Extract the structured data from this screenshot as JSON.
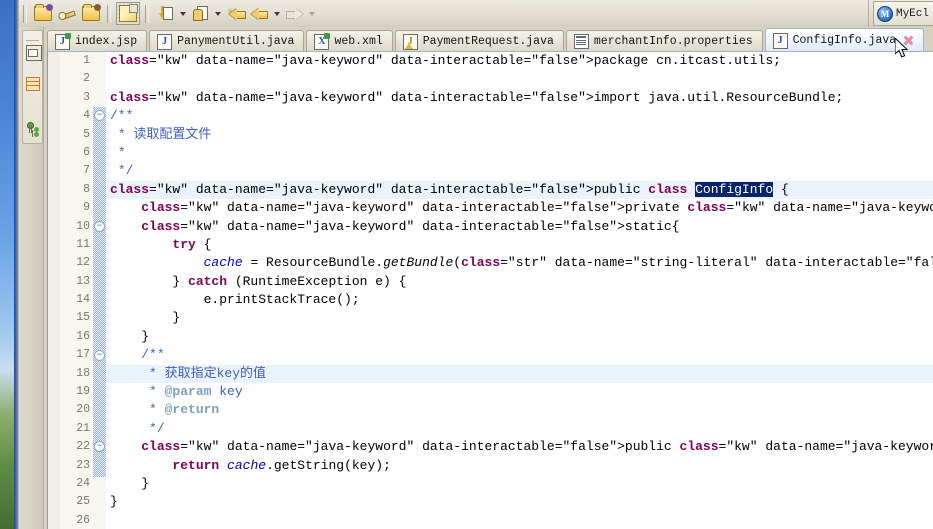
{
  "window": {
    "perspective_label": "MyEcl",
    "perspective_icon": "myeclipse-icon"
  },
  "toolbar": {
    "items": [
      {
        "name": "open-type-button",
        "icon": "folder-purple-icon",
        "tooltip": "Open Type"
      },
      {
        "name": "new-wizard-button",
        "icon": "magic-wand-icon",
        "tooltip": "New Wizard"
      },
      {
        "name": "open-resource-button",
        "icon": "folder-brown-icon",
        "tooltip": "Open Resource"
      },
      {
        "name": "save-button",
        "icon": "save-java-icon",
        "tooltip": "Save"
      },
      {
        "name": "run-button",
        "icon": "download-page-icon",
        "tooltip": "Run"
      },
      {
        "name": "run-dropdown",
        "icon": "chevron-down-icon",
        "tooltip": "Run History"
      },
      {
        "name": "external-tools-button",
        "icon": "hand-page-icon",
        "tooltip": "External Tools"
      },
      {
        "name": "external-tools-dropdown",
        "icon": "chevron-down-icon",
        "tooltip": "External Tools History"
      },
      {
        "name": "next-annotation-button",
        "icon": "sparkle-arrow-left-icon",
        "tooltip": "Next Annotation"
      },
      {
        "name": "back-button",
        "icon": "arrow-left-icon",
        "tooltip": "Back"
      },
      {
        "name": "back-dropdown",
        "icon": "chevron-down-icon",
        "tooltip": "Back History"
      },
      {
        "name": "forward-button",
        "icon": "arrow-right-icon",
        "tooltip": "Forward"
      },
      {
        "name": "forward-dropdown",
        "icon": "chevron-down-icon",
        "tooltip": "Forward History"
      }
    ]
  },
  "fastview": {
    "items": [
      {
        "name": "restore-view-button",
        "icon": "restore-icon"
      },
      {
        "name": "outline-view-button",
        "icon": "outline-icon"
      },
      {
        "name": "hierarchy-view-button",
        "icon": "hierarchy-icon"
      }
    ]
  },
  "editor": {
    "tabs": [
      {
        "label": "index.jsp",
        "icon": "jsp-file-icon",
        "active": false,
        "closable": false
      },
      {
        "label": "PanymentUtil.java",
        "icon": "java-file-icon",
        "active": false,
        "closable": false
      },
      {
        "label": "web.xml",
        "icon": "xml-file-icon",
        "active": false,
        "closable": false
      },
      {
        "label": "PaymentRequest.java",
        "icon": "java-warning-icon",
        "active": false,
        "closable": false
      },
      {
        "label": "merchantInfo.properties",
        "icon": "properties-file-icon",
        "active": false,
        "closable": false
      },
      {
        "label": "ConfigInfo.java",
        "icon": "java-file-icon",
        "active": true,
        "closable": true
      }
    ],
    "close_icon": "close-icon",
    "first_line": 1,
    "last_line": 26,
    "highlighted_lines": [
      8,
      18
    ],
    "selection_text": "ConfigInfo",
    "fold_markers": [
      4,
      10,
      17,
      22
    ],
    "lines": [
      {
        "n": 1,
        "text": "package cn.itcast.utils;"
      },
      {
        "n": 2,
        "text": ""
      },
      {
        "n": 3,
        "text": "import java.util.ResourceBundle;"
      },
      {
        "n": 4,
        "text": "/**"
      },
      {
        "n": 5,
        "text": " * 读取配置文件"
      },
      {
        "n": 6,
        "text": " *"
      },
      {
        "n": 7,
        "text": " */"
      },
      {
        "n": 8,
        "text": "public class ConfigInfo {"
      },
      {
        "n": 9,
        "text": "    private static ResourceBundle cache = null;"
      },
      {
        "n": 10,
        "text": "    static{"
      },
      {
        "n": 11,
        "text": "        try {"
      },
      {
        "n": 12,
        "text": "            cache = ResourceBundle.getBundle(\"merchantInfo\");"
      },
      {
        "n": 13,
        "text": "        } catch (RuntimeException e) {"
      },
      {
        "n": 14,
        "text": "            e.printStackTrace();"
      },
      {
        "n": 15,
        "text": "        }"
      },
      {
        "n": 16,
        "text": "    }"
      },
      {
        "n": 17,
        "text": "    /**"
      },
      {
        "n": 18,
        "text": "     * 获取指定key的值"
      },
      {
        "n": 19,
        "text": "     * @param key"
      },
      {
        "n": 20,
        "text": "     * @return"
      },
      {
        "n": 21,
        "text": "     */"
      },
      {
        "n": 22,
        "text": "    public static String getValue(String key){"
      },
      {
        "n": 23,
        "text": "        return cache.getString(key);"
      },
      {
        "n": 24,
        "text": "    }"
      },
      {
        "n": 25,
        "text": "}"
      },
      {
        "n": 26,
        "text": ""
      }
    ]
  },
  "colors": {
    "keyword": "#7f0055",
    "string": "#2a00ff",
    "comment": "#3f7f5f",
    "javadoc": "#3f5fbf",
    "javadoc_tag": "#7f9fbf",
    "field": "#0000c0",
    "selection_bg": "#0a246a",
    "current_line_bg": "#eaf2fc",
    "chrome_bg": "#d6d2c2"
  }
}
